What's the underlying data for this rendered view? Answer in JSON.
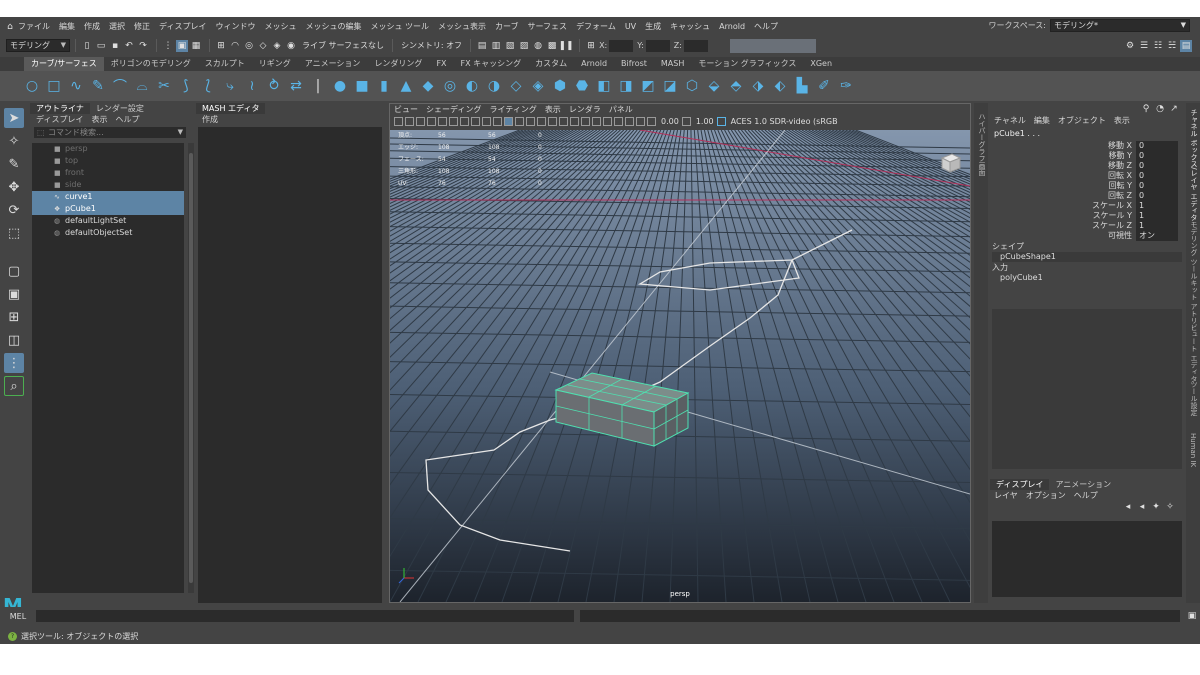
{
  "menubar": {
    "items": [
      "ファイル",
      "編集",
      "作成",
      "選択",
      "修正",
      "ディスプレイ",
      "ウィンドウ",
      "メッシュ",
      "メッシュの編集",
      "メッシュ ツール",
      "メッシュ表示",
      "カーブ",
      "サーフェス",
      "デフォーム",
      "UV",
      "生成",
      "キャッシュ",
      "Arnold",
      "ヘルプ"
    ],
    "workspace_label": "ワークスペース:",
    "workspace_value": "モデリング*"
  },
  "statusline": {
    "mode": "モデリング",
    "live_label": "ライブ サーフェスなし",
    "symmetry_label": "シンメトリ: オフ",
    "x_label": "X:",
    "y_label": "Y:",
    "z_label": "Z:"
  },
  "shelf": {
    "tabs": [
      "カーブ/サーフェス",
      "ポリゴンのモデリング",
      "スカルプト",
      "リギング",
      "アニメーション",
      "レンダリング",
      "FX",
      "FX キャッシング",
      "カスタム",
      "Arnold",
      "Bifrost",
      "MASH",
      "モーション グラフィックス",
      "XGen"
    ],
    "active_tab": 0
  },
  "outliner": {
    "tabs": [
      "アウトライナ",
      "レンダー設定"
    ],
    "menu": [
      "ディスプレイ",
      "表示",
      "ヘルプ"
    ],
    "search_placeholder": "コマンド検索...",
    "items": [
      {
        "label": "persp",
        "state": "dim"
      },
      {
        "label": "top",
        "state": "dim"
      },
      {
        "label": "front",
        "state": "dim"
      },
      {
        "label": "side",
        "state": "dim"
      },
      {
        "label": "curve1",
        "state": "sel"
      },
      {
        "label": "pCube1",
        "state": "sel"
      },
      {
        "label": "defaultLightSet",
        "state": "normal"
      },
      {
        "label": "defaultObjectSet",
        "state": "normal"
      }
    ]
  },
  "mash": {
    "tab": "MASH エディタ",
    "menu": "作成"
  },
  "viewport": {
    "menu": [
      "ビュー",
      "シェーディング",
      "ライティング",
      "表示",
      "レンダラ",
      "パネル"
    ],
    "exposure": "0.00",
    "gamma": "1.00",
    "color_space": "ACES 1.0 SDR-video (sRGB",
    "camera_label": "persp",
    "hud": [
      {
        "label": "頂点:",
        "a": "56",
        "b": "56",
        "c": "0"
      },
      {
        "label": "エッジ:",
        "a": "108",
        "b": "108",
        "c": "0"
      },
      {
        "label": "フェース:",
        "a": "54",
        "b": "54",
        "c": "0"
      },
      {
        "label": "三角形:",
        "a": "108",
        "b": "108",
        "c": "0"
      },
      {
        "label": "UV:",
        "a": "76",
        "b": "76",
        "c": "0"
      }
    ]
  },
  "sidestrip_label": "ハイパーグラフ画面",
  "channelbox": {
    "menu": [
      "チャネル",
      "編集",
      "オブジェクト",
      "表示"
    ],
    "object": "pCube1 . . .",
    "attributes": [
      {
        "name": "移動 X",
        "value": "0"
      },
      {
        "name": "移動 Y",
        "value": "0"
      },
      {
        "name": "移動 Z",
        "value": "0"
      },
      {
        "name": "回転 X",
        "value": "0"
      },
      {
        "name": "回転 Y",
        "value": "0"
      },
      {
        "name": "回転 Z",
        "value": "0"
      },
      {
        "name": "スケール X",
        "value": "1"
      },
      {
        "name": "スケール Y",
        "value": "1"
      },
      {
        "name": "スケール Z",
        "value": "1"
      },
      {
        "name": "可視性",
        "value": "オン"
      }
    ],
    "shape_heading": "シェイプ",
    "shape_node": "pCubeShape1",
    "input_heading": "入力",
    "input_node": "polyCube1"
  },
  "layers": {
    "tabs": [
      "ディスプレイ",
      "アニメーション"
    ],
    "menu": [
      "レイヤ",
      "オプション",
      "ヘルプ"
    ]
  },
  "rightstrip": [
    "チャネル ボックス/レイヤ エディタ",
    "モデリング ツールキット",
    "アトリビュート エディタ",
    "ツール設定",
    "Human IK"
  ],
  "cmdline": {
    "label": "MEL"
  },
  "help": {
    "text": "選択ツール: オブジェクトの選択"
  }
}
